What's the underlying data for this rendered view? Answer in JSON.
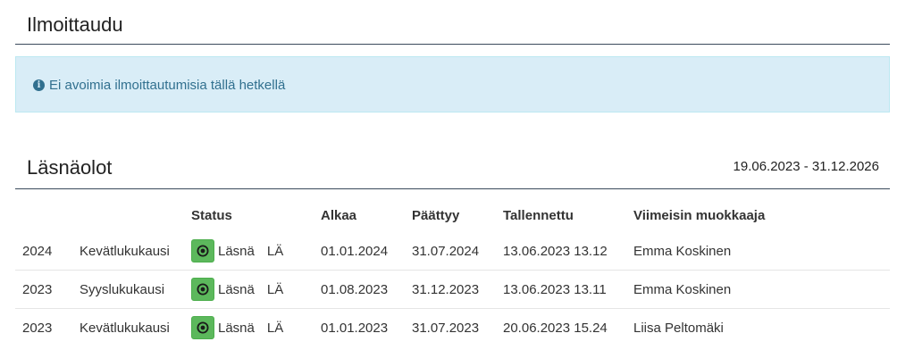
{
  "signup": {
    "title": "Ilmoittaudu",
    "info_message": "Ei avoimia ilmoittautumisia tällä hetkellä",
    "info_icon": "info-circle-icon"
  },
  "attendance": {
    "title": "Läsnäolot",
    "date_range": "19.06.2023 - 31.12.2026",
    "columns": {
      "year": "",
      "term": "",
      "status": "Status",
      "start": "Alkaa",
      "end": "Päättyy",
      "saved": "Tallennettu",
      "editor": "Viimeisin muokkaaja"
    },
    "status_icon": "dot-circle-icon",
    "status_color": "#5cb85c",
    "rows": [
      {
        "year": "2024",
        "term": "Kevätlukukausi",
        "status": "Läsnä",
        "code": "LÄ",
        "start": "01.01.2024",
        "end": "31.07.2024",
        "saved": "13.06.2023 13.12",
        "editor": "Emma Koskinen"
      },
      {
        "year": "2023",
        "term": "Syyslukukausi",
        "status": "Läsnä",
        "code": "LÄ",
        "start": "01.08.2023",
        "end": "31.12.2023",
        "saved": "13.06.2023 13.11",
        "editor": "Emma Koskinen"
      },
      {
        "year": "2023",
        "term": "Kevätlukukausi",
        "status": "Läsnä",
        "code": "LÄ",
        "start": "01.01.2023",
        "end": "31.07.2023",
        "saved": "20.06.2023 15.24",
        "editor": "Liisa Peltomäki"
      }
    ]
  }
}
